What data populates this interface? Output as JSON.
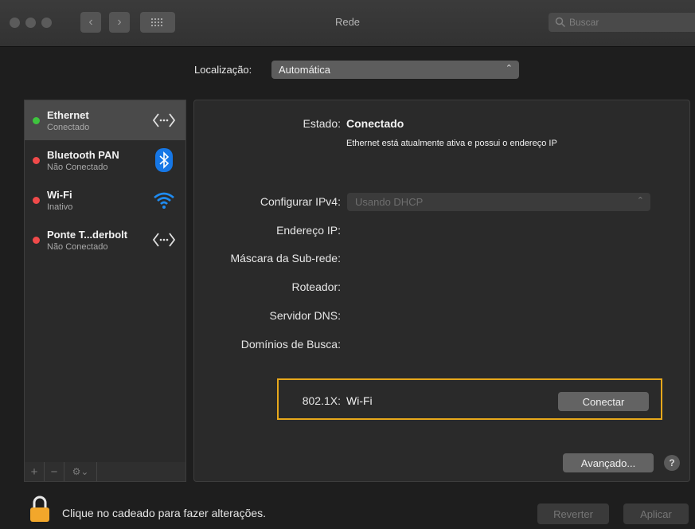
{
  "window": {
    "title": "Rede",
    "search_placeholder": "Buscar"
  },
  "location": {
    "label": "Localização:",
    "value": "Automática"
  },
  "services": [
    {
      "name": "Ethernet",
      "status": "Conectado",
      "status_color": "#3ec43e",
      "icon": "ethernet-icon",
      "selected": true
    },
    {
      "name": "Bluetooth PAN",
      "status": "Não Conectado",
      "status_color": "#f04a4a",
      "icon": "bluetooth-icon",
      "selected": false
    },
    {
      "name": "Wi-Fi",
      "status": "Inativo",
      "status_color": "#f04a4a",
      "icon": "wifi-icon",
      "selected": false
    },
    {
      "name": "Ponte T...derbolt",
      "status": "Não Conectado",
      "status_color": "#f04a4a",
      "icon": "ethernet-icon",
      "selected": false
    }
  ],
  "sidebar_tools": {
    "add": "+",
    "remove": "−",
    "gear_menu": "⚙⌄"
  },
  "details": {
    "state_label": "Estado:",
    "state_value": "Conectado",
    "state_description": "Ethernet está atualmente ativa e possui o endereço IP",
    "ipv4_label": "Configurar IPv4:",
    "ipv4_value": "Usando DHCP",
    "ip_label": "Endereço IP:",
    "mask_label": "Máscara da Sub-rede:",
    "router_label": "Roteador:",
    "dns_label": "Servidor DNS:",
    "domains_label": "Domínios de Busca:",
    "dot1x_label": "802.1X:",
    "dot1x_value": "Wi-Fi",
    "connect_button": "Conectar",
    "advanced_button": "Avançado...",
    "help": "?"
  },
  "footer": {
    "lock_text": "Clique no cadeado para fazer alterações.",
    "revert_button": "Reverter",
    "apply_button": "Aplicar"
  },
  "colors": {
    "highlight": "#e7a81b",
    "lock": "#f2a72b"
  }
}
